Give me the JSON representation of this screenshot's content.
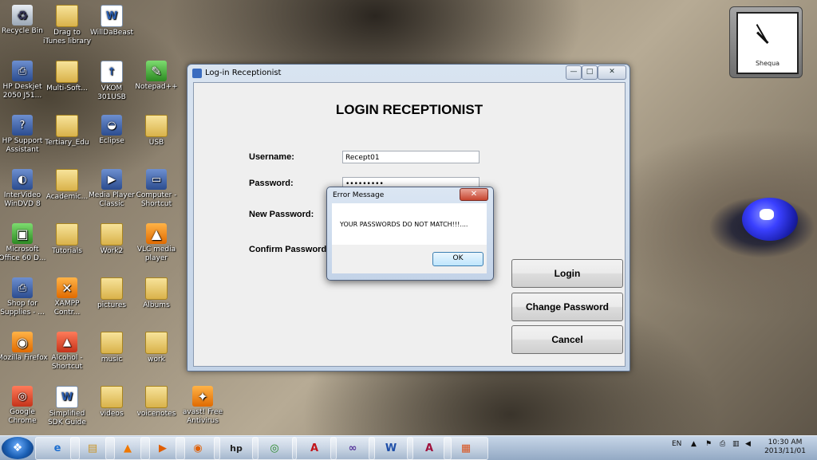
{
  "desktop_icons": [
    {
      "label": "Recycle Bin",
      "icon": "recycle-bin-icon"
    },
    {
      "label": "Drag to iTunes library",
      "icon": "folder-icon"
    },
    {
      "label": "WillDaBeast",
      "icon": "word-document-icon"
    },
    {
      "label": "HP Deskjet 2050 J51...",
      "icon": "printer-icon"
    },
    {
      "label": "Multi-Soft...",
      "icon": "folder-icon"
    },
    {
      "label": "VKOM 301USB",
      "icon": "app-icon"
    },
    {
      "label": "Notepad++",
      "icon": "notepad-icon"
    },
    {
      "label": "HP Support Assistant",
      "icon": "hp-support-icon"
    },
    {
      "label": "Tertiary_Edu",
      "icon": "folder-icon"
    },
    {
      "label": "Eclipse",
      "icon": "eclipse-icon"
    },
    {
      "label": "USB",
      "icon": "folder-icon"
    },
    {
      "label": "InterVideo WinDVD 8",
      "icon": "dvd-icon"
    },
    {
      "label": "Academic...",
      "icon": "folder-icon"
    },
    {
      "label": "Media Player Classic",
      "icon": "media-player-icon"
    },
    {
      "label": "Computer - Shortcut",
      "icon": "computer-icon"
    },
    {
      "label": "Microsoft Office 60 D...",
      "icon": "office-icon"
    },
    {
      "label": "Tutorials",
      "icon": "folder-icon"
    },
    {
      "label": "Work2",
      "icon": "folder-icon"
    },
    {
      "label": "VLC media player",
      "icon": "vlc-icon"
    },
    {
      "label": "Shop for Supplies - ...",
      "icon": "printer-icon"
    },
    {
      "label": "XAMPP Contr...",
      "icon": "xampp-icon"
    },
    {
      "label": "pictures",
      "icon": "folder-icon"
    },
    {
      "label": "Albums",
      "icon": "folder-icon"
    },
    {
      "label": "Mozilla Firefox",
      "icon": "firefox-icon"
    },
    {
      "label": "Alcohol - Shortcut",
      "icon": "alcohol-icon"
    },
    {
      "label": "music",
      "icon": "folder-icon"
    },
    {
      "label": "work",
      "icon": "folder-icon"
    },
    {
      "label": "Google Chrome",
      "icon": "chrome-icon"
    },
    {
      "label": "Simplified SDK Guide",
      "icon": "word-document-icon"
    },
    {
      "label": "videos",
      "icon": "folder-icon"
    },
    {
      "label": "voicenotes",
      "icon": "folder-icon"
    },
    {
      "label": "avast! Free Antivirus",
      "icon": "avast-icon"
    }
  ],
  "clock_gadget": {
    "label": "Shequa"
  },
  "window": {
    "title": "Log-in Receptionist",
    "heading": "LOGIN RECEPTIONIST",
    "username_label": "Username:",
    "username_value": "Recept01",
    "password_label": "Password:",
    "password_value": "•••••••••",
    "new_password_label": "New Password:",
    "confirm_password_label": "Confirm Password:",
    "login_button": "Login",
    "change_password_button": "Change Password",
    "cancel_button": "Cancel",
    "minimize": "—",
    "maximize": "□",
    "close": "✕"
  },
  "dialog": {
    "title": "Error Message",
    "message": "YOUR PASSWORDS DO NOT MATCH!!!....",
    "ok_button": "OK",
    "close": "✕"
  },
  "taskbar": {
    "start": "❖",
    "language": "EN",
    "time": "10:30 AM",
    "date": "2013/11/01",
    "apps": [
      {
        "name": "internet-explorer",
        "glyph": "e"
      },
      {
        "name": "file-explorer",
        "glyph": "▤"
      },
      {
        "name": "vlc",
        "glyph": "▲"
      },
      {
        "name": "media-player",
        "glyph": "▶"
      },
      {
        "name": "firefox",
        "glyph": "◉"
      },
      {
        "name": "hp",
        "glyph": "hp"
      },
      {
        "name": "chrome",
        "glyph": "◎"
      },
      {
        "name": "acrobat",
        "glyph": "A"
      },
      {
        "name": "visual-studio",
        "glyph": "∞"
      },
      {
        "name": "word",
        "glyph": "W"
      },
      {
        "name": "access",
        "glyph": "A"
      },
      {
        "name": "windows-forms-app",
        "glyph": "▦"
      }
    ]
  }
}
